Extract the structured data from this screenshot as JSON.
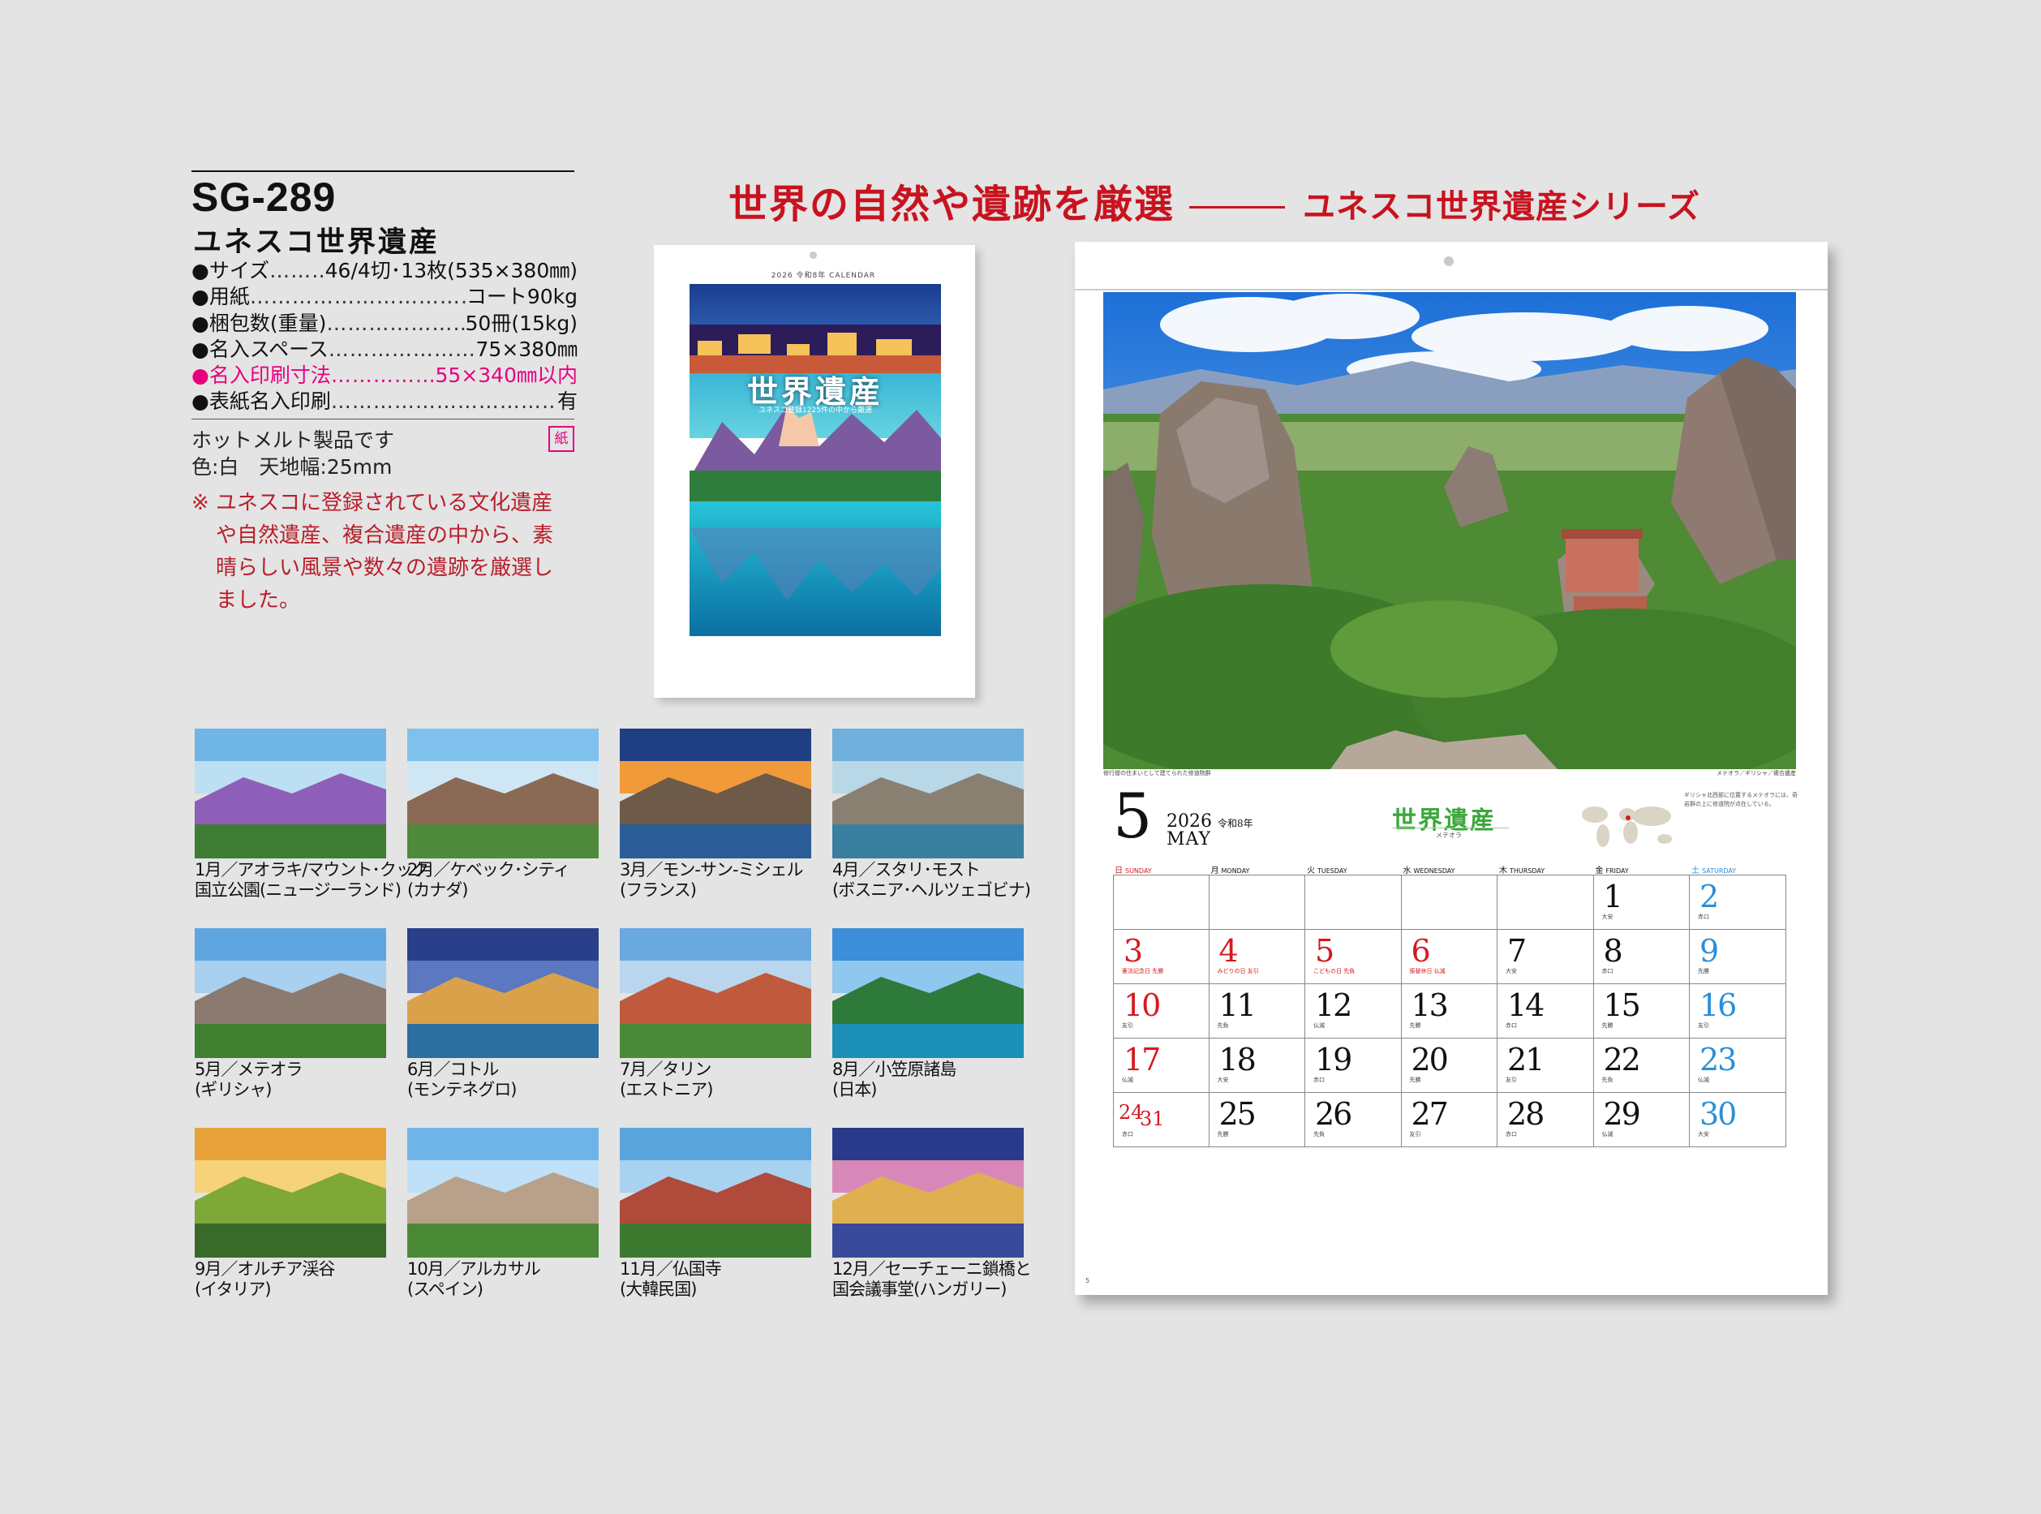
{
  "product": {
    "code": "SG-289",
    "name": "ユネスコ世界遺産",
    "specs": [
      {
        "label": "●サイズ",
        "value": "46/4切･13枚(535×380㎜)",
        "highlight": false
      },
      {
        "label": "●用紙",
        "value": "コート90kg",
        "highlight": false
      },
      {
        "label": "●梱包数(重量)",
        "value": "50冊(15kg)",
        "highlight": false
      },
      {
        "label": "●名入スペース",
        "value": "75×380㎜",
        "highlight": false
      },
      {
        "label": "●名入印刷寸法",
        "value": "55×340㎜以内",
        "highlight": true
      },
      {
        "label": "●表紙名入印刷",
        "value": "有",
        "highlight": false
      }
    ],
    "paper_badge": "紙",
    "note_line1": "ホットメルト製品です",
    "note_line2": "色:白　天地幅:25mm",
    "description": [
      "※ ユネスコに登録されている文化遺産",
      "や自然遺産、複合遺産の中から、素",
      "晴らしい風景や数々の遺跡を厳選し",
      "ました。"
    ]
  },
  "headline": {
    "main": "世界の自然や遺跡を厳選",
    "sub": "ユネスコ世界遺産シリーズ"
  },
  "cover": {
    "topline": "2026 令和8年 CALENDAR",
    "title": "世界遺産",
    "subtitle": "ユネスコ登録1225件の中から厳選"
  },
  "months": [
    {
      "line1": "1月／アオラキ/マウント･クック",
      "line2": "国立公園(ニュージーランド)"
    },
    {
      "line1": "2月／ケベック･シティ",
      "line2": "(カナダ)"
    },
    {
      "line1": "3月／モン-サン-ミシェル",
      "line2": "(フランス)"
    },
    {
      "line1": "4月／スタリ･モスト",
      "line2": "(ボスニア･ヘルツェゴビナ)"
    },
    {
      "line1": "5月／メテオラ",
      "line2": "(ギリシャ)"
    },
    {
      "line1": "6月／コトル",
      "line2": "(モンテネグロ)"
    },
    {
      "line1": "7月／タリン",
      "line2": "(エストニア)"
    },
    {
      "line1": "8月／小笠原諸島",
      "line2": "(日本)"
    },
    {
      "line1": "9月／オルチア渓谷",
      "line2": "(イタリア)"
    },
    {
      "line1": "10月／アルカサル",
      "line2": "(スペイン)"
    },
    {
      "line1": "11月／仏国寺",
      "line2": "(大韓民国)"
    },
    {
      "line1": "12月／セーチェーニ鎖橋と",
      "line2": "国会議事堂(ハンガリー)"
    }
  ],
  "calendar": {
    "month_number": "5",
    "year": "2026",
    "era": "令和8年",
    "month_name": "MAY",
    "logo": "世界遺産",
    "logo_sub": "メテオラ",
    "photo_caption_left": "修行僧の住まいとして建てられた修道院群",
    "photo_caption_right": "メテオラ／ギリシャ／複合遺産",
    "blurb": "ギリシャ北西部に位置するメテオラには、奇岩群の上に修道院が点在している。",
    "page_no": "5",
    "weekdays": [
      {
        "kanji": "日",
        "en": "SUNDAY"
      },
      {
        "kanji": "月",
        "en": "MONDAY"
      },
      {
        "kanji": "火",
        "en": "TUESDAY"
      },
      {
        "kanji": "水",
        "en": "WEDNESDAY"
      },
      {
        "kanji": "木",
        "en": "THURSDAY"
      },
      {
        "kanji": "金",
        "en": "FRIDAY"
      },
      {
        "kanji": "土",
        "en": "SATURDAY"
      }
    ],
    "weeks": [
      [
        {
          "d": ""
        },
        {
          "d": ""
        },
        {
          "d": ""
        },
        {
          "d": ""
        },
        {
          "d": ""
        },
        {
          "d": "1",
          "s": "大安"
        },
        {
          "d": "2",
          "s": "赤口"
        }
      ],
      [
        {
          "d": "3",
          "s": "憲法記念日 先勝"
        },
        {
          "d": "4",
          "s": "みどりの日 友引"
        },
        {
          "d": "5",
          "s": "こどもの日 先負"
        },
        {
          "d": "6",
          "s": "振替休日 仏滅"
        },
        {
          "d": "7",
          "s": "大安"
        },
        {
          "d": "8",
          "s": "赤口"
        },
        {
          "d": "9",
          "s": "先勝"
        }
      ],
      [
        {
          "d": "10",
          "s": "友引"
        },
        {
          "d": "11",
          "s": "先負"
        },
        {
          "d": "12",
          "s": "仏滅"
        },
        {
          "d": "13",
          "s": "先勝"
        },
        {
          "d": "14",
          "s": "赤口"
        },
        {
          "d": "15",
          "s": "先勝"
        },
        {
          "d": "16",
          "s": "友引"
        }
      ],
      [
        {
          "d": "17",
          "s": "仏滅"
        },
        {
          "d": "18",
          "s": "大安"
        },
        {
          "d": "19",
          "s": "赤口"
        },
        {
          "d": "20",
          "s": "先勝"
        },
        {
          "d": "21",
          "s": "友引"
        },
        {
          "d": "22",
          "s": "先負"
        },
        {
          "d": "23",
          "s": "仏滅"
        }
      ],
      [
        {
          "d": "24",
          "d2": "31",
          "s": "赤口"
        },
        {
          "d": "25",
          "s": "先勝"
        },
        {
          "d": "26",
          "s": "先負"
        },
        {
          "d": "27",
          "s": "友引"
        },
        {
          "d": "28",
          "s": "赤口"
        },
        {
          "d": "29",
          "s": "仏滅"
        },
        {
          "d": "30",
          "s": "大安"
        }
      ]
    ]
  },
  "colors": {
    "headline_red": "#c8131f",
    "spec_pink": "#e6007e",
    "sunday_red": "#d71920",
    "saturday_blue": "#2a8fd6",
    "logo_green": "#3aa83a"
  }
}
